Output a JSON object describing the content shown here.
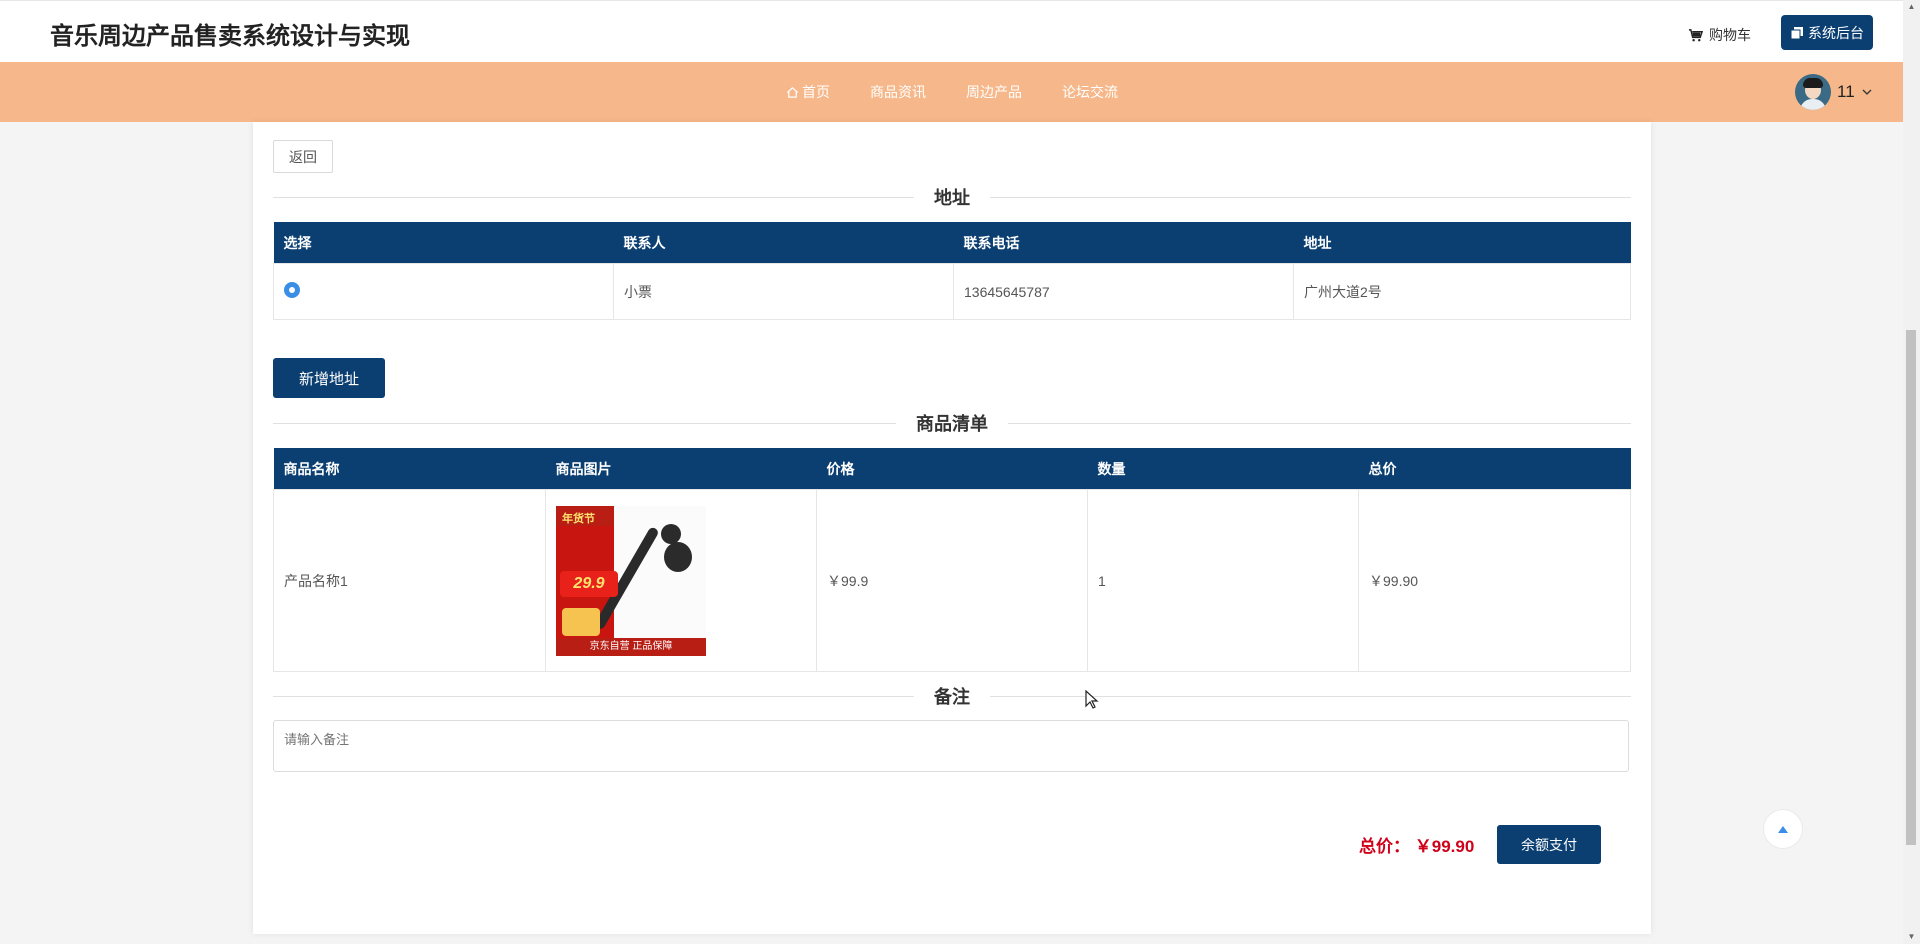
{
  "header": {
    "site_title": "音乐周边产品售卖系统设计与实现",
    "cart_label": "购物车",
    "admin_label": "系统后台"
  },
  "nav": {
    "items": [
      {
        "label": "首页"
      },
      {
        "label": "商品资讯"
      },
      {
        "label": "周边产品"
      },
      {
        "label": "论坛交流"
      }
    ],
    "user_name": "11"
  },
  "back_label": "返回",
  "address_section": {
    "title": "地址",
    "columns": [
      "选择",
      "联系人",
      "联系电话",
      "地址"
    ],
    "rows": [
      {
        "selected": true,
        "contact": "小票",
        "phone": "13645645787",
        "address": "广州大道2号"
      }
    ],
    "add_button": "新增地址"
  },
  "order_section": {
    "title": "商品清单",
    "columns": [
      "商品名称",
      "商品图片",
      "价格",
      "数量",
      "总价"
    ],
    "rows": [
      {
        "name": "产品名称1",
        "image_icon": "hulusi-product-image",
        "price": "￥99.9",
        "quantity": "1",
        "total": "￥99.90"
      }
    ],
    "image_text": {
      "promo_top": "年货节",
      "price_tag": "29.9",
      "bottom_banner": "京东自营 正品保障"
    }
  },
  "remark_section": {
    "title": "备注",
    "placeholder": "请输入备注",
    "value": ""
  },
  "footer": {
    "total_label": "总价：",
    "total_value": "￥99.90",
    "pay_button": "余额支付"
  },
  "colors": {
    "primary": "#0b3f72",
    "nav_bg": "#f6b88a",
    "price_red": "#d0021b"
  }
}
